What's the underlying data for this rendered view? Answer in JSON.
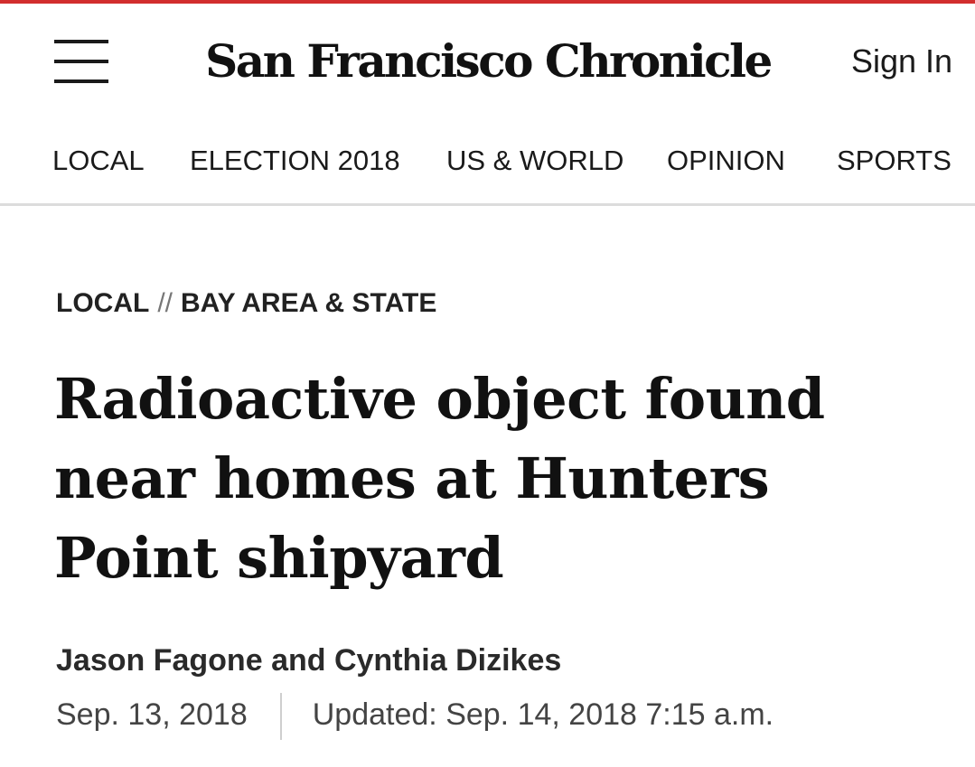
{
  "header": {
    "menu_icon": "hamburger-menu-icon",
    "masthead": "San Francisco Chronicle",
    "sign_in": "Sign In"
  },
  "nav": {
    "items": [
      {
        "label": "LOCAL"
      },
      {
        "label": "ELECTION 2018"
      },
      {
        "label": "US & WORLD"
      },
      {
        "label": "OPINION"
      },
      {
        "label": "SPORTS"
      }
    ]
  },
  "article": {
    "section": "LOCAL",
    "separator": "//",
    "subsection": "BAY AREA & STATE",
    "headline": "Radioactive object found near homes at Hunters Point shipyard",
    "authors": [
      "Jason Fagone",
      "Cynthia Dizikes"
    ],
    "author_joiner": "and",
    "published": "Sep. 13, 2018",
    "updated": "Updated: Sep. 14, 2018 7:15 a.m."
  },
  "colors": {
    "accent": "#d22e2e",
    "text": "#1a1a1a",
    "rule": "#dcdcdc"
  }
}
